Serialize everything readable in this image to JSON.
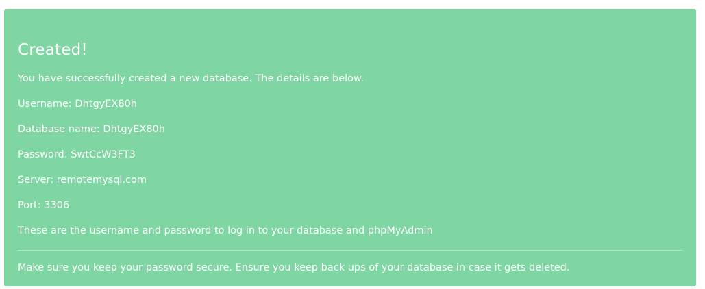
{
  "alert": {
    "title": "Created!",
    "intro": "You have successfully created a new database. The details are below.",
    "username_line": "Username: DhtgyEX80h",
    "database_line": "Database name: DhtgyEX80h",
    "password_line": "Password: SwtCcW3FT3",
    "server_line": "Server: remotemysql.com",
    "port_line": "Port: 3306",
    "note": "These are the username and password to log in to your database and phpMyAdmin",
    "warning": "Make sure you keep your password secure. Ensure you keep back ups of your database in case it gets deleted."
  },
  "colors": {
    "background": "#7fd6a3",
    "text": "#ffffff"
  }
}
